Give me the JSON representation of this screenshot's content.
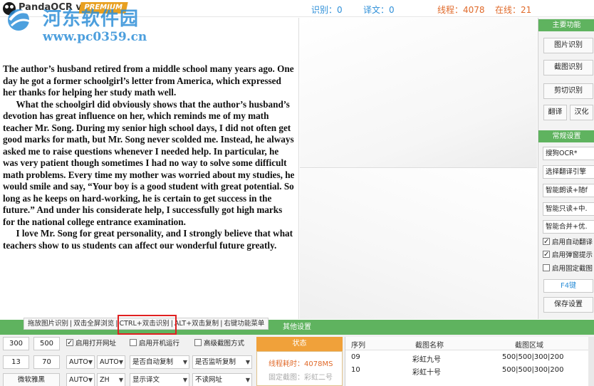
{
  "app": {
    "title": "PandaOCR v2.4",
    "badge": "PREMIUM"
  },
  "watermark": {
    "site_name": "河东软件园",
    "url": "www.pc0359.cn"
  },
  "stats": {
    "recognize": "识别：0",
    "translate": "译文：0",
    "threads": "线程：4078",
    "online": "在线：21"
  },
  "ocr_paragraphs": [
    {
      "indent": false,
      "text": "The author’s husband retired from a middle school many years ago. One day he got a former schoolgirl’s letter from America, which expressed her thanks for helping her study math well."
    },
    {
      "indent": true,
      "text": "What the schoolgirl did obviously shows that the author’s husband’s devotion has great influence on her, which reminds me of my math teacher Mr. Song. During my senior high school days, I did not often get good marks for math, but Mr. Song never scolded me. Instead, he always asked me to raise questions whenever I needed help. In particular, he was very patient though sometimes I had no way to solve some difficult math problems. Every time my mother was worried about my studies, he would smile and say, “Your boy is a good student with great potential. So long as he keeps on hard-working, he is certain to get success in the future.” And under his considerate help, I successfully got high marks for the national college entrance examination."
    },
    {
      "indent": true,
      "text": "I love Mr. Song for great personality, and I strongly believe that what teachers show to us students can affect our wonderful future greatly."
    }
  ],
  "sidebar": {
    "main_header": "主要功能",
    "btn_image_ocr": "图片识别",
    "btn_screenshot_ocr": "截图识别",
    "btn_clipboard_ocr": "剪切识别",
    "btn_translate": "翻译",
    "btn_chinese": "汉化",
    "settings_header": "常规设置",
    "select_engine": "搜狗OCR*",
    "select_translate_engine": "选择翻译引擎",
    "select_read": "智能朗读+随f",
    "select_read_only": "智能只读+中.",
    "select_merge": "智能合并+优.",
    "check_auto_translate": "启用自动翻译",
    "check_popup_hint": "启用弹窗提示",
    "check_fixed_screenshot": "启用固定截图",
    "f4_key": "F4键",
    "save_settings": "保存设置"
  },
  "hints": {
    "drag_image": "拖放图片识别",
    "double_click_fullscreen": "双击全屏浏览",
    "ctrl_double_click": "CTRL+双击识别",
    "alt_double_click": "ALT+双击复制",
    "right_click_menu": "右键功能菜单"
  },
  "other_settings": {
    "header": "其他设置",
    "width": "300",
    "height": "500",
    "offset_x": "13",
    "offset_y": "70",
    "check_open_url": "启用打开网址",
    "check_startup": "启用开机运行",
    "check_advanced_screenshot": "高级截图方式",
    "auto_select_1": "AUTO",
    "auto_select_2": "AUTO",
    "auto_copy_select": "是否自动复制",
    "listen_copy_select": "是否监听复制",
    "ms_yahei_button": "微软雅黑",
    "lang_auto": "AUTO",
    "lang_zh": "ZH",
    "show_translation_select": "显示译文",
    "no_url_select": "不读网址"
  },
  "status": {
    "header": "状态",
    "thread_time": "线程耗时：4078MS",
    "fixed_screenshot": "固定截图：彩虹二号"
  },
  "table": {
    "columns": [
      "序列",
      "截图名称",
      "截图区域"
    ],
    "rows": [
      {
        "seq": "09",
        "name": "彩虹九号",
        "area": "500|500|300|200"
      },
      {
        "seq": "10",
        "name": "彩虹十号",
        "area": "500|500|300|200"
      }
    ]
  },
  "colors": {
    "accent_green": "#5fb35f",
    "accent_orange": "#f0a13a",
    "stat_blue": "#2e8fd8",
    "stat_orange": "#e06a2a",
    "highlight_red": "#e02020"
  }
}
